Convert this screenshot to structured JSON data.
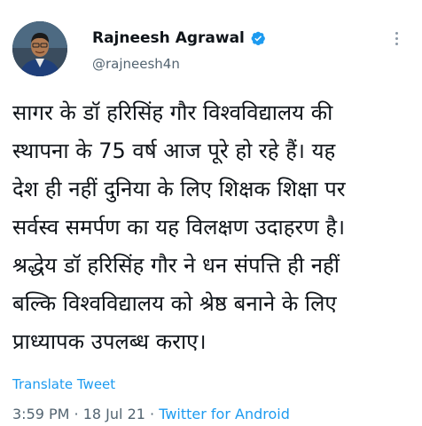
{
  "author": {
    "display_name": "Rajneesh Agrawal",
    "handle": "@rajneesh4n",
    "verified_icon": "verified-badge-icon",
    "avatar_icon": "profile-photo"
  },
  "more_icon": "more-vertical-icon",
  "tweet": {
    "lines": [
      "सागर के डॉ हरिसिंह गौर विश्वविद्यालय की",
      "स्थापना के 75 वर्ष आज पूरे हो रहे हैं। यह",
      "देश ही नहीं दुनिया के लिए शिक्षक शिक्षा पर",
      "सर्वस्व समर्पण का यह विलक्षण उदाहरण है।",
      "श्रद्धेय डॉ हरिसिंह गौर ने  धन संपत्ति ही नहीं",
      "बल्कि विश्वविद्यालय को श्रेष्ठ बनाने के लिए",
      "प्राध्यापक उपलब्ध कराए।"
    ]
  },
  "translate_label": "Translate Tweet",
  "meta": {
    "time": "3:59 PM",
    "separator": " · ",
    "date": "18 Jul 21",
    "source": "Twitter for Android"
  },
  "colors": {
    "accent": "#1d9bf0",
    "text": "#0f1419",
    "muted": "#536471"
  }
}
